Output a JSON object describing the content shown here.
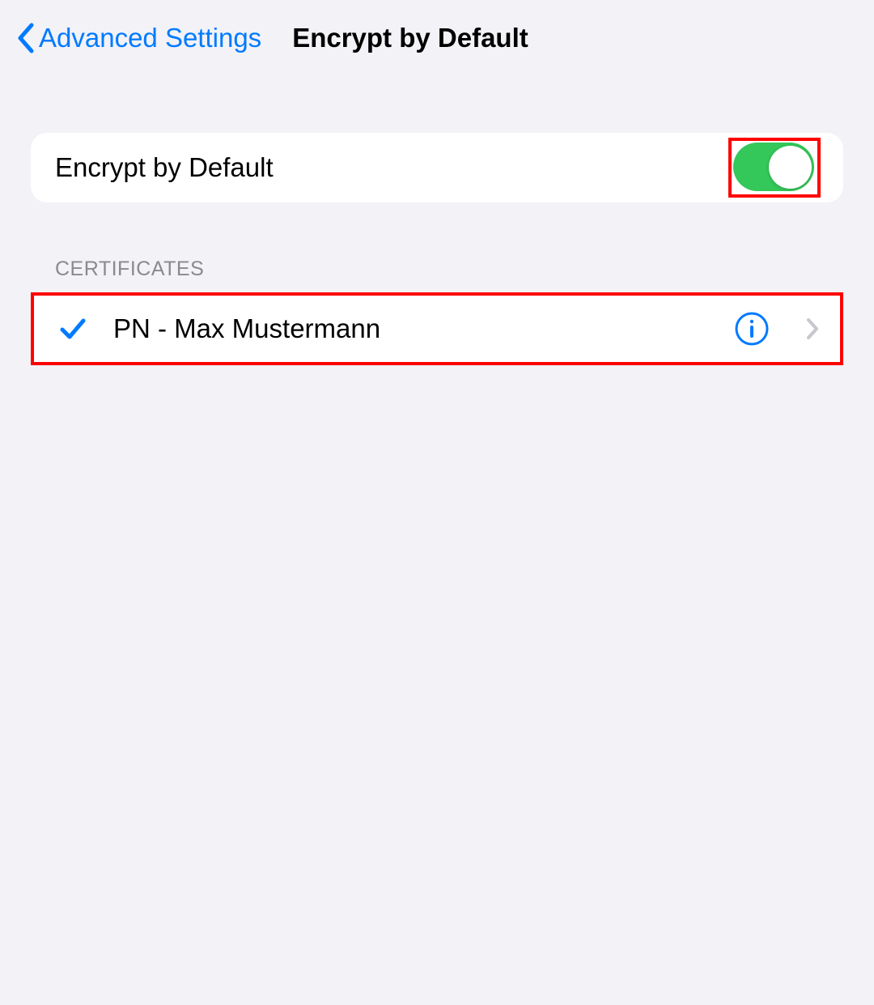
{
  "header": {
    "back_label": "Advanced Settings",
    "title": "Encrypt by Default"
  },
  "switchRow": {
    "label": "Encrypt by Default",
    "on": true
  },
  "certificates": {
    "section_header": "CERTIFICATES",
    "items": [
      {
        "name": "PN - Max Mustermann",
        "selected": true
      }
    ]
  }
}
